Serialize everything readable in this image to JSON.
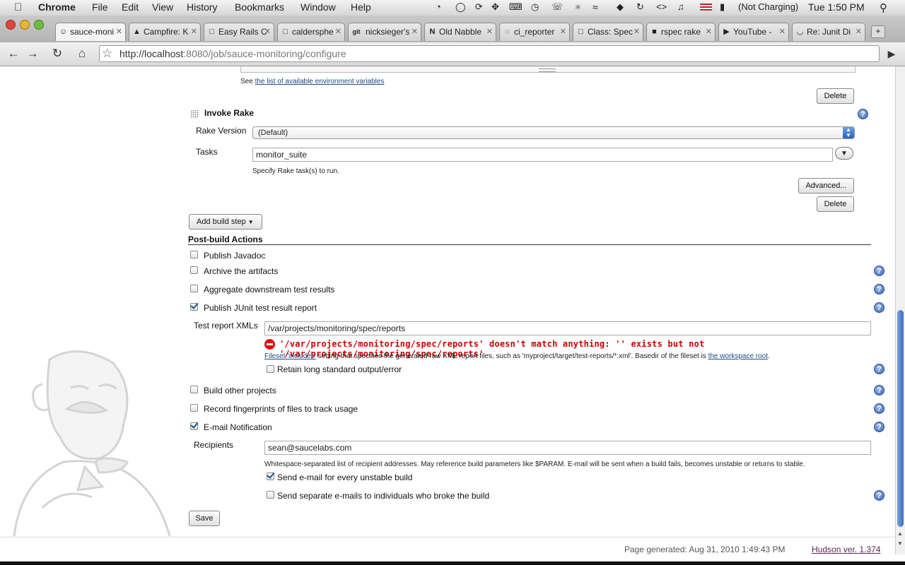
{
  "menubar": {
    "app": "Chrome",
    "items": [
      "File",
      "Edit",
      "View",
      "History",
      "Bookmarks",
      "Window",
      "Help"
    ],
    "battery": "(Not Charging)",
    "clock": "Tue 1:50 PM"
  },
  "tabs": [
    {
      "label": "sauce-moni",
      "active": true
    },
    {
      "label": "Campfire: K"
    },
    {
      "label": "Easy Rails C"
    },
    {
      "label": "caldersphe"
    },
    {
      "label": "nicksieger's"
    },
    {
      "label": "Old Nabble"
    },
    {
      "label": "ci_reporter"
    },
    {
      "label": "Class: Spec"
    },
    {
      "label": "rspec rake"
    },
    {
      "label": "YouTube -"
    },
    {
      "label": "Re: Junit Di"
    }
  ],
  "toolbar": {
    "url_host": "http://localhost",
    "url_rest": ":8080/job/sauce-monitoring/configure"
  },
  "page": {
    "env_vars_prefix": "See",
    "env_vars_link": "the list of available environment variables",
    "delete_label": "Delete",
    "invoke_rake_title": "Invoke Rake",
    "rake_version_label": "Rake Version",
    "rake_version_value": "(Default)",
    "tasks_label": "Tasks",
    "tasks_value": "monitor_suite",
    "tasks_help": "Specify Rake task(s) to run.",
    "advanced_label": "Advanced...",
    "add_build_step_label": "Add build step",
    "post_build_title": "Post-build Actions",
    "publish_javadoc": "Publish Javadoc",
    "archive_artifacts": "Archive the artifacts",
    "aggregate_downstream": "Aggregate downstream test results",
    "publish_junit": "Publish JUnit test result report",
    "test_report_label": "Test report XMLs",
    "test_report_value": "/var/projects/monitoring/spec/reports",
    "error_text": "'/var/projects/monitoring/spec/reports' doesn't match anything: '' exists but not '/var/projects/monitoring/spec/reports'",
    "fileset_link": "Fileset 'includes'",
    "fileset_text": "setting that specifies the generated raw XML report files, such as 'myproject/target/test-reports/*.xml'. Basedir of the fileset is",
    "workspace_link": "the workspace root",
    "retain_output": "Retain long standard output/error",
    "build_other": "Build other projects",
    "record_fingerprints": "Record fingerprints of files to track usage",
    "email_notification": "E-mail Notification",
    "recipients_label": "Recipients",
    "recipients_value": "sean@saucelabs.com",
    "recipients_help": "Whitespace-separated list of recipient addresses. May reference build parameters like $PARAM. E-mail will be sent when a build fails, becomes unstable or returns to stable.",
    "send_unstable": "Send e-mail for every unstable build",
    "send_separate": "Send separate e-mails to individuals who broke the build",
    "save_label": "Save"
  },
  "footer": {
    "generated": "Page generated: Aug 31, 2010 1:49:43 PM",
    "version": "Hudson ver. 1.374"
  },
  "colors": {
    "error": "#cc0000",
    "link": "#204a87",
    "scroll_thumb": "#3a6fc2"
  }
}
